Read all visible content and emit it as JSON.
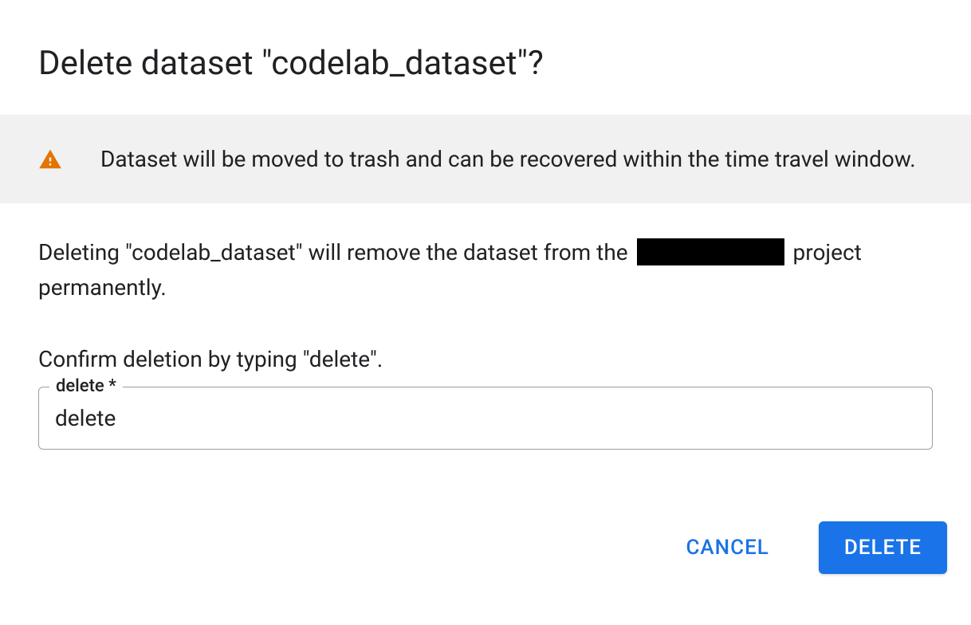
{
  "dialog": {
    "title": "Delete dataset \"codelab_dataset\"?",
    "banner_text": "Dataset will be moved to trash and can be recovered within the time travel window.",
    "description_prefix": "Deleting \"codelab_dataset\" will remove the dataset from the ",
    "description_suffix": " project permanently.",
    "confirm_instruction": "Confirm deletion by typing \"delete\".",
    "input_label": "delete *",
    "input_value": "delete",
    "cancel_label": "CANCEL",
    "delete_label": "DELETE"
  }
}
